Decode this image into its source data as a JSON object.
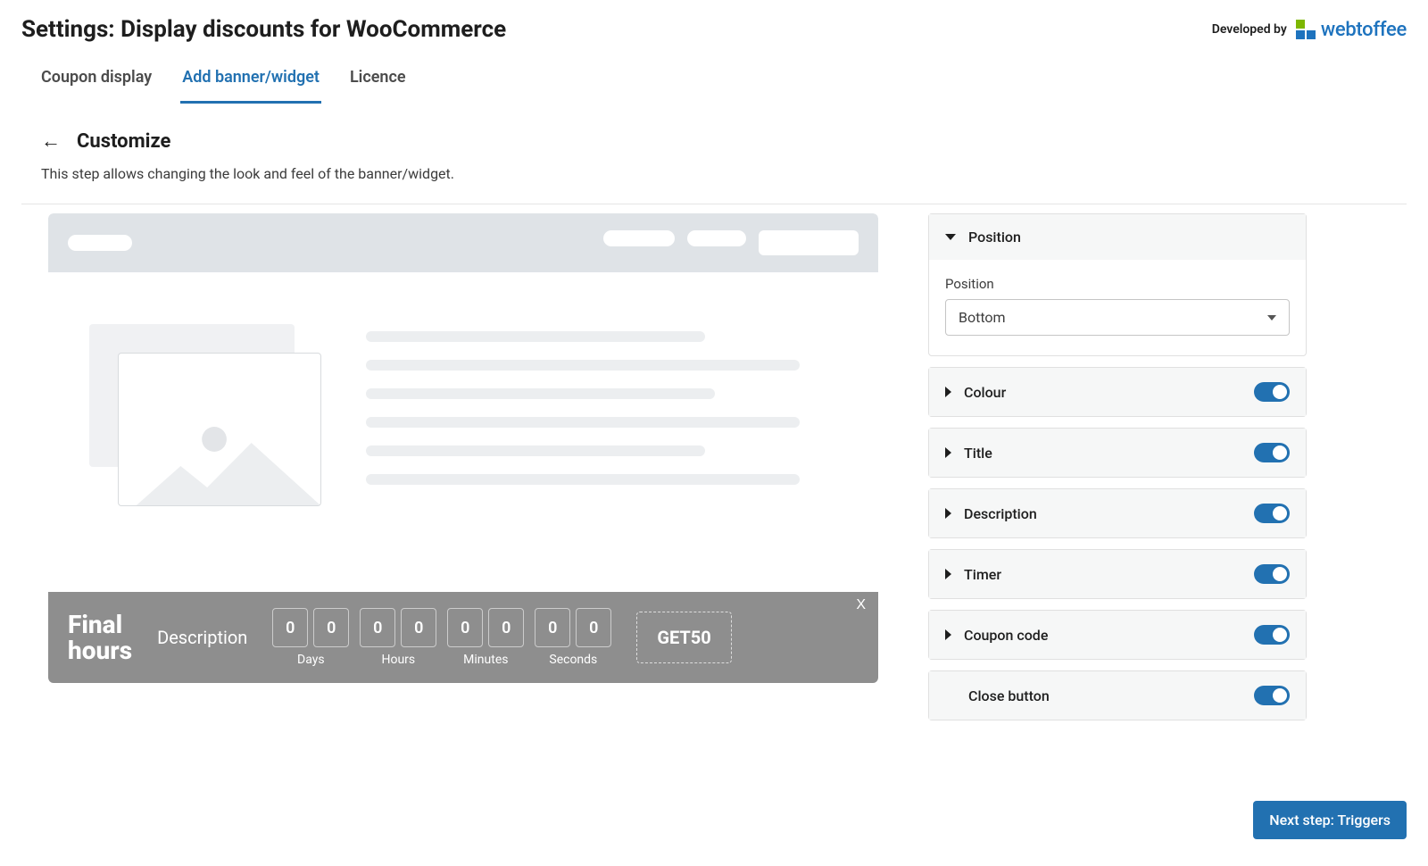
{
  "header": {
    "title": "Settings: Display discounts for WooCommerce",
    "developed_by": "Developed by",
    "brand": "webtoffee"
  },
  "tabs": [
    {
      "label": "Coupon display",
      "active": false
    },
    {
      "label": "Add banner/widget",
      "active": true
    },
    {
      "label": "Licence",
      "active": false
    }
  ],
  "sub": {
    "title": "Customize",
    "desc": "This step allows changing the look and feel of the banner/widget."
  },
  "preview_banner": {
    "title": "Final\nhours",
    "description": "Description",
    "close": "X",
    "timer": {
      "days": {
        "d1": "0",
        "d2": "0",
        "label": "Days"
      },
      "hours": {
        "d1": "0",
        "d2": "0",
        "label": "Hours"
      },
      "minutes": {
        "d1": "0",
        "d2": "0",
        "label": "Minutes"
      },
      "seconds": {
        "d1": "0",
        "d2": "0",
        "label": "Seconds"
      }
    },
    "coupon": "GET50"
  },
  "panel": {
    "position": {
      "header": "Position",
      "field_label": "Position",
      "value": "Bottom"
    },
    "sections": [
      {
        "label": "Colour",
        "toggle": true
      },
      {
        "label": "Title",
        "toggle": true
      },
      {
        "label": "Description",
        "toggle": true
      },
      {
        "label": "Timer",
        "toggle": true
      },
      {
        "label": "Coupon code",
        "toggle": true
      },
      {
        "label": "Close button",
        "toggle": true,
        "no_caret": true
      }
    ]
  },
  "footer": {
    "next": "Next step: Triggers"
  }
}
